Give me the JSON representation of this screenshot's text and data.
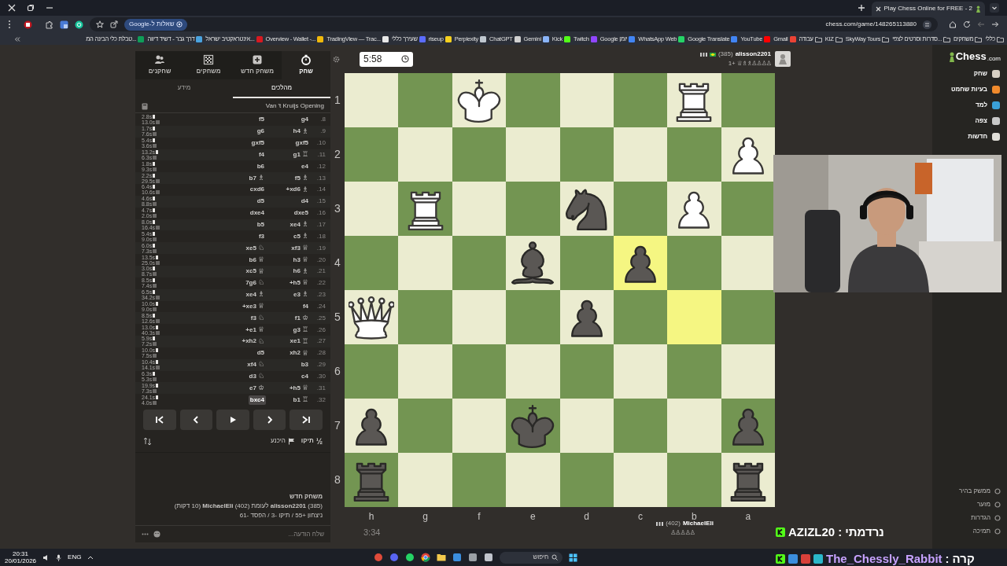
{
  "browser": {
    "tab": {
      "title": "Play Chess Online for FREE - 2"
    },
    "address": {
      "url": "chess.com/game/148265113880",
      "google_chip": "שאלות ל-Google"
    },
    "bookmarks": [
      {
        "label": "טבלת כלי הבינה המ...",
        "kind": "site",
        "color": "#0f9d58"
      },
      {
        "label": "דרך גבר - דשיד דיווה",
        "kind": "site",
        "color": "#4aa3df"
      },
      {
        "label": "אינטראקטיב ישראל...",
        "kind": "site",
        "color": "#d71920"
      },
      {
        "label": "Overview - Wallet -...",
        "kind": "site",
        "color": "#f0b90b"
      },
      {
        "label": "TradingView — Trac...",
        "kind": "site",
        "color": "#e8e8e8"
      },
      {
        "label": "שעירך כללי",
        "kind": "site",
        "color": "#5b6cff"
      },
      {
        "label": "riseup",
        "kind": "site",
        "color": "#f5d01f"
      },
      {
        "label": "Perplexity",
        "kind": "site",
        "color": "#bfc7cf"
      },
      {
        "label": "ChatGPT",
        "kind": "site",
        "color": "#d0d0d0"
      },
      {
        "label": "Gemini",
        "kind": "site",
        "color": "#8ab4f8"
      },
      {
        "label": "Kick",
        "kind": "site",
        "color": "#53fc18"
      },
      {
        "label": "Twitch",
        "kind": "site",
        "color": "#9146ff"
      },
      {
        "label": "Google יומן",
        "kind": "site",
        "color": "#4285f4"
      },
      {
        "label": "WhatsApp Web",
        "kind": "site",
        "color": "#25d366"
      },
      {
        "label": "Google Translate",
        "kind": "site",
        "color": "#4285f4"
      },
      {
        "label": "YouTube",
        "kind": "site",
        "color": "#ff0000"
      },
      {
        "label": "Gmail",
        "kind": "site",
        "color": "#ea4335"
      },
      {
        "label": "עבודה",
        "kind": "folder"
      },
      {
        "label": "KIZ",
        "kind": "folder"
      },
      {
        "label": "SkyWay Tours",
        "kind": "folder"
      },
      {
        "label": "סדרות וסרטים לצפי...",
        "kind": "folder"
      },
      {
        "label": "משחקים",
        "kind": "folder"
      },
      {
        "label": "כללי",
        "kind": "folder"
      }
    ]
  },
  "side_panel": {
    "top_tabs": [
      {
        "label": "שחק",
        "kind": "timer",
        "selected": true
      },
      {
        "label": "משחק חדש",
        "kind": "plus",
        "selected": false
      },
      {
        "label": "משחקים",
        "kind": "board",
        "selected": false
      },
      {
        "label": "שחקנים",
        "kind": "people",
        "selected": false
      }
    ],
    "sub_tabs": [
      {
        "label": "מהלכים",
        "selected": true
      },
      {
        "label": "מידע",
        "selected": false
      }
    ],
    "opening": "Van 't Kruijs Opening",
    "moves": [
      {
        "number": "8.",
        "white": {
          "san": "g4",
          "selected": false
        },
        "black": {
          "san": "f5",
          "selected": false
        },
        "white_time": "2.8s",
        "black_time": "13.0s"
      },
      {
        "number": "9.",
        "white": {
          "san": "h4",
          "glyph": "♗",
          "selected": false
        },
        "black": {
          "san": "g6",
          "selected": false
        },
        "white_time": "1.7s",
        "black_time": "7.6s"
      },
      {
        "number": "10.",
        "white": {
          "san": "gxf5",
          "selected": false
        },
        "black": {
          "san": "gxf5",
          "selected": false
        },
        "white_time": "5.4s",
        "black_time": "3.6s"
      },
      {
        "number": "11.",
        "white": {
          "san": "g1",
          "glyph": "♖",
          "selected": false
        },
        "black": {
          "san": "f4",
          "selected": false
        },
        "white_time": "13.2s",
        "black_time": "6.3s"
      },
      {
        "number": "12.",
        "white": {
          "san": "e4",
          "selected": false
        },
        "black": {
          "san": "b6",
          "selected": false
        },
        "white_time": "1.8s",
        "black_time": "9.3s"
      },
      {
        "number": "13.",
        "white": {
          "san": "f5",
          "glyph": "♗",
          "selected": false
        },
        "black": {
          "san": "b7",
          "glyph": "♗",
          "selected": false
        },
        "white_time": "2.2s",
        "black_time": "29.5s"
      },
      {
        "number": "14.",
        "white": {
          "san": "xd6+",
          "glyph": "♗",
          "selected": false
        },
        "black": {
          "san": "cxd6",
          "selected": false
        },
        "white_time": "6.4s",
        "black_time": "10.6s"
      },
      {
        "number": "15.",
        "white": {
          "san": "d4",
          "selected": false
        },
        "black": {
          "san": "d5",
          "selected": false
        },
        "white_time": "4.6s",
        "black_time": "8.8s"
      },
      {
        "number": "16.",
        "white": {
          "san": "dxe5",
          "selected": false
        },
        "black": {
          "san": "dxe4",
          "selected": false
        },
        "white_time": "4.7s",
        "black_time": "2.0s"
      },
      {
        "number": "17.",
        "white": {
          "san": "xe4",
          "glyph": "♗",
          "selected": false
        },
        "black": {
          "san": "b5",
          "selected": false
        },
        "white_time": "8.0s",
        "black_time": "16.4s"
      },
      {
        "number": "18.",
        "white": {
          "san": "c5",
          "glyph": "♗",
          "selected": false
        },
        "black": {
          "san": "f3",
          "selected": false
        },
        "white_time": "5.4s",
        "black_time": "9.0s"
      },
      {
        "number": "19.",
        "white": {
          "san": "xf3",
          "glyph": "♕",
          "selected": false
        },
        "black": {
          "san": "xe5",
          "glyph": "♘",
          "selected": false
        },
        "white_time": "6.0s",
        "black_time": "7.3s"
      },
      {
        "number": "20.",
        "white": {
          "san": "h3",
          "glyph": "♕",
          "selected": false
        },
        "black": {
          "san": "b6",
          "glyph": "♕",
          "selected": false
        },
        "white_time": "13.5s",
        "black_time": "25.0s"
      },
      {
        "number": "21.",
        "white": {
          "san": "h6",
          "glyph": "♗",
          "selected": false
        },
        "black": {
          "san": "xc5",
          "glyph": "♕",
          "selected": false
        },
        "white_time": "3.0s",
        "black_time": "8.7s"
      },
      {
        "number": "22.",
        "white": {
          "san": "h5+",
          "glyph": "♕",
          "selected": false
        },
        "black": {
          "san": "7g6",
          "glyph": "♘",
          "selected": false
        },
        "white_time": "8.5s",
        "black_time": "7.4s"
      },
      {
        "number": "23.",
        "white": {
          "san": "e3",
          "glyph": "♗",
          "selected": false
        },
        "black": {
          "san": "xe4",
          "glyph": "♗",
          "selected": false
        },
        "white_time": "6.5s",
        "black_time": "34.2s"
      },
      {
        "number": "24.",
        "white": {
          "san": "f4",
          "selected": false
        },
        "black": {
          "san": "xe3+",
          "glyph": "♕",
          "selected": false
        },
        "white_time": "10.0s",
        "black_time": "9.0s"
      },
      {
        "number": "25.",
        "white": {
          "san": "f1",
          "glyph": "♔",
          "selected": false
        },
        "black": {
          "san": "f3",
          "glyph": "♘",
          "selected": false
        },
        "white_time": "8.5s",
        "black_time": "12.6s"
      },
      {
        "number": "26.",
        "white": {
          "san": "g3",
          "glyph": "♖",
          "selected": false
        },
        "black": {
          "san": "e1+",
          "glyph": "♕",
          "selected": false
        },
        "white_time": "13.0s",
        "black_time": "40.3s"
      },
      {
        "number": "27.",
        "white": {
          "san": "xe1",
          "glyph": "♖",
          "selected": false
        },
        "black": {
          "san": "xh2+",
          "glyph": "♘",
          "selected": false
        },
        "white_time": "5.9s",
        "black_time": "7.2s"
      },
      {
        "number": "28.",
        "white": {
          "san": "xh2",
          "glyph": "♕",
          "selected": false
        },
        "black": {
          "san": "d5",
          "selected": false
        },
        "white_time": "10.0s",
        "black_time": "7.5s"
      },
      {
        "number": "29.",
        "white": {
          "san": "b3",
          "selected": false
        },
        "black": {
          "san": "xf4",
          "glyph": "♘",
          "selected": false
        },
        "white_time": "10.4s",
        "black_time": "14.1s"
      },
      {
        "number": "30.",
        "white": {
          "san": "c4",
          "selected": false
        },
        "black": {
          "san": "d3",
          "glyph": "♘",
          "selected": false
        },
        "white_time": "6.3s",
        "black_time": "5.3s"
      },
      {
        "number": "31.",
        "white": {
          "san": "h5+",
          "glyph": "♕",
          "selected": false
        },
        "black": {
          "san": "e7",
          "glyph": "♔",
          "selected": false
        },
        "white_time": "19.9s",
        "black_time": "7.3s"
      },
      {
        "number": "32.",
        "white": {
          "san": "b1",
          "glyph": "♖",
          "selected": false
        },
        "black": {
          "san": "bxc4",
          "selected": true
        },
        "white_time": "24.1s",
        "black_time": "4.0s"
      }
    ],
    "draw": {
      "glyph": "½",
      "label": "תיקו"
    },
    "resign": {
      "label": "היכנע"
    },
    "chat": {
      "title": "משחק חדש",
      "lines": [
        "(385) **alisson2201** לעומת (402) **MichaelEli** (10 דקות)",
        "ניצחון +55 / תיקו -3 / הפסד -61"
      ],
      "placeholder": "שלח הודעה..."
    }
  },
  "game": {
    "top_clock": "5:58",
    "top_player": {
      "name": "alisson2201",
      "rating": "(385)",
      "advantage": "1+",
      "captured": "♕♗♗♙♙♙♙"
    },
    "bottom_clock": "3:34",
    "bottom_player": {
      "name": "MichaelEli",
      "rating": "(402)",
      "captured": "♙♙♙♙♙"
    },
    "ranks": [
      "1",
      "2",
      "3",
      "4",
      "5",
      "6",
      "7",
      "8"
    ],
    "files": [
      "h",
      "g",
      "f",
      "e",
      "d",
      "c",
      "b",
      "a"
    ],
    "squares": [
      [
        {
          "highlighted": false
        },
        {
          "highlighted": false
        },
        {
          "kind": "king",
          "white": true,
          "highlighted": false
        },
        {
          "highlighted": false
        },
        {
          "highlighted": false
        },
        {
          "highlighted": false
        },
        {
          "kind": "rook",
          "white": true,
          "highlighted": false
        },
        {
          "highlighted": false
        }
      ],
      [
        {
          "highlighted": false
        },
        {
          "highlighted": false
        },
        {
          "highlighted": false
        },
        {
          "highlighted": false
        },
        {
          "highlighted": false
        },
        {
          "highlighted": false
        },
        {
          "highlighted": false
        },
        {
          "kind": "pawn",
          "white": true,
          "highlighted": false
        }
      ],
      [
        {
          "highlighted": false
        },
        {
          "kind": "rook",
          "white": true,
          "highlighted": false
        },
        {
          "highlighted": false
        },
        {
          "highlighted": false
        },
        {
          "kind": "knight",
          "white": false,
          "highlighted": false
        },
        {
          "highlighted": false
        },
        {
          "kind": "pawn",
          "white": true,
          "highlighted": false
        },
        {
          "highlighted": false
        }
      ],
      [
        {
          "highlighted": false
        },
        {
          "highlighted": false
        },
        {
          "highlighted": false
        },
        {
          "kind": "bishop",
          "white": false,
          "highlighted": false
        },
        {
          "highlighted": false
        },
        {
          "kind": "pawn",
          "white": false,
          "highlighted": true
        },
        {
          "highlighted": false
        },
        {
          "highlighted": false
        }
      ],
      [
        {
          "kind": "queen",
          "white": true,
          "highlighted": false
        },
        {
          "highlighted": false
        },
        {
          "highlighted": false
        },
        {
          "highlighted": false
        },
        {
          "kind": "pawn",
          "white": false,
          "highlighted": false
        },
        {
          "highlighted": false
        },
        {
          "highlighted": true
        },
        {
          "highlighted": false
        }
      ],
      [
        {
          "highlighted": false
        },
        {
          "highlighted": false
        },
        {
          "highlighted": false
        },
        {
          "highlighted": false
        },
        {
          "highlighted": false
        },
        {
          "highlighted": false
        },
        {
          "highlighted": false
        },
        {
          "highlighted": false
        }
      ],
      [
        {
          "kind": "pawn",
          "white": false,
          "highlighted": false
        },
        {
          "highlighted": false
        },
        {
          "highlighted": false
        },
        {
          "kind": "king",
          "white": false,
          "highlighted": false
        },
        {
          "highlighted": false
        },
        {
          "highlighted": false
        },
        {
          "highlighted": false
        },
        {
          "kind": "pawn",
          "white": false,
          "highlighted": false
        }
      ],
      [
        {
          "kind": "rook",
          "white": false,
          "highlighted": false
        },
        {
          "highlighted": false
        },
        {
          "highlighted": false
        },
        {
          "highlighted": false
        },
        {
          "highlighted": false
        },
        {
          "highlighted": false
        },
        {
          "highlighted": false
        },
        {
          "kind": "rook",
          "white": false,
          "highlighted": false
        }
      ]
    ]
  },
  "sidebar": {
    "logo": "Chess",
    "logo_suffix": ".com",
    "items": [
      {
        "label": "שחק",
        "color": "#d8d0c4"
      },
      {
        "label": "בעיות שחמט",
        "color": "#f08a2c"
      },
      {
        "label": "למד",
        "color": "#3aa0d8"
      },
      {
        "label": "צפה",
        "color": "#c8c8c8"
      },
      {
        "label": "חדשות",
        "color": "#e0ded8"
      }
    ],
    "footer": [
      "ממשק בהיר",
      "מזער",
      "הגדרות",
      "תמיכה"
    ]
  },
  "stream_chat": [
    {
      "user": "AZIZL20",
      "separator": ":",
      "message": "נרדמתי",
      "color": "#ffffff"
    },
    {
      "user": "The_Chessly_Rabbit",
      "separator": ":",
      "message": "קרה",
      "color": "#c7a2ff"
    }
  ],
  "taskbar": {
    "time": "20:31",
    "date": "20/01/2026",
    "language": "ENG",
    "search_placeholder": "חיפוש"
  }
}
